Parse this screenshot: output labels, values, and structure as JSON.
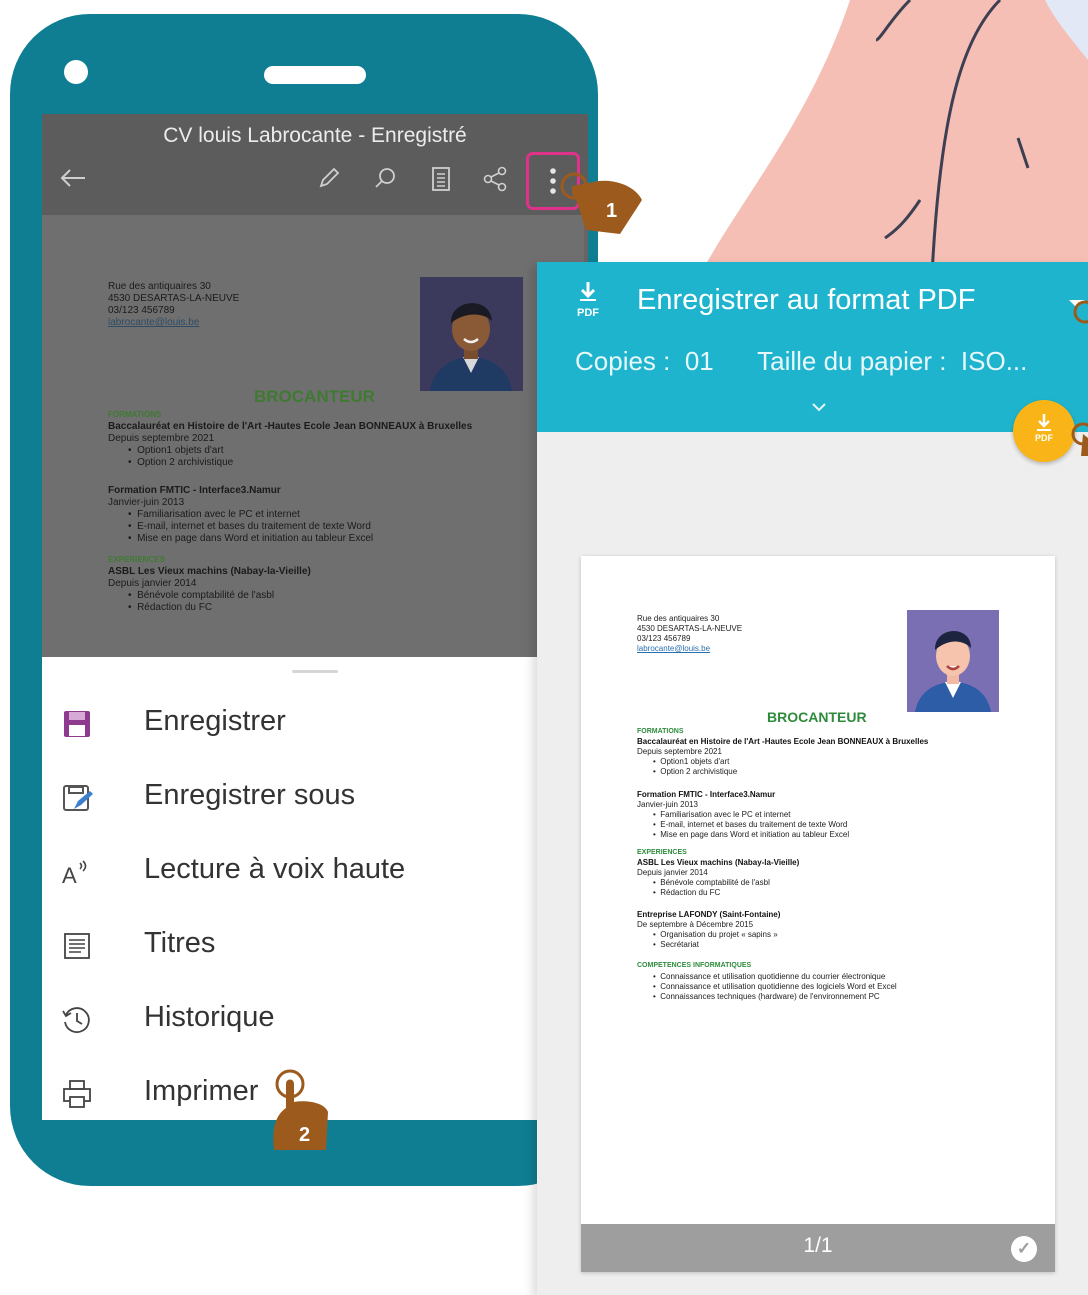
{
  "app": {
    "document_title": "CV louis Labrocante - Enregistré"
  },
  "toolbar": {
    "icons": [
      "back-arrow-icon",
      "pencil-icon",
      "search-icon",
      "reading-view-icon",
      "share-icon",
      "more-options-icon"
    ]
  },
  "cv": {
    "address_lines": [
      "Rue des antiquaires 30",
      "4530 DESARTAS-LA-NEUVE",
      "03/123 456789"
    ],
    "email": "labrocante@louis.be",
    "job_title": "BROCANTEUR",
    "sections": [
      {
        "heading": "FORMATIONS",
        "entries": [
          {
            "title": "Baccalauréat en Histoire de l'Art -Hautes Ecole Jean BONNEAUX à Bruxelles",
            "date": "Depuis septembre 2021",
            "bullets": [
              "Option1 objets d'art",
              "Option 2 archivistique"
            ]
          },
          {
            "title": "Formation FMTIC - Interface3.Namur",
            "date": "Janvier-juin 2013",
            "bullets": [
              "Familiarisation avec le PC et internet",
              "E-mail, internet et bases du traitement de texte Word",
              "Mise en page dans Word et initiation au tableur Excel"
            ]
          }
        ]
      },
      {
        "heading": "EXPERIENCES",
        "entries": [
          {
            "title": "ASBL Les Vieux machins (Nabay-la-Vieille)",
            "date": "Depuis janvier 2014",
            "bullets": [
              "Bénévole comptabilité de l'asbl",
              "Rédaction du FC"
            ]
          },
          {
            "title": "Entreprise LAFONDY (Saint-Fontaine)",
            "date": "De septembre à Décembre 2015",
            "bullets": [
              "Organisation du projet « sapins »",
              "Secrétariat"
            ]
          }
        ]
      },
      {
        "heading": "COMPETENCES INFORMATIQUES",
        "entries": [
          {
            "title": "",
            "date": "",
            "bullets": [
              "Connaissance et utilisation quotidienne du courrier électronique",
              "Connaissance et utilisation quotidienne des logiciels Word et Excel",
              "Connaissances techniques (hardware) de l'environnement PC"
            ]
          }
        ]
      }
    ]
  },
  "menu": {
    "items": [
      {
        "label": "Enregistrer",
        "icon": "save-icon"
      },
      {
        "label": "Enregistrer sous",
        "icon": "save-as-icon"
      },
      {
        "label": "Lecture à voix haute",
        "icon": "read-aloud-icon"
      },
      {
        "label": "Titres",
        "icon": "headings-icon"
      },
      {
        "label": "Historique",
        "icon": "history-icon"
      },
      {
        "label": "Imprimer",
        "icon": "print-icon"
      }
    ]
  },
  "print": {
    "pdf_badge": "PDF",
    "destination": "Enregistrer au format PDF",
    "copies_label": "Copies :",
    "copies_value": "01",
    "paper_label": "Taille du papier :",
    "paper_value": "ISO...",
    "page_indicator": "1/1"
  },
  "steps": {
    "step1": "1",
    "step2": "2"
  },
  "colors": {
    "phone": "#0f7e92",
    "print_header": "#1fb4cd",
    "fab": "#f9b417",
    "highlight": "#e0328b",
    "finger": "#9c5b1c",
    "save_icon": "#8e3a8e"
  }
}
